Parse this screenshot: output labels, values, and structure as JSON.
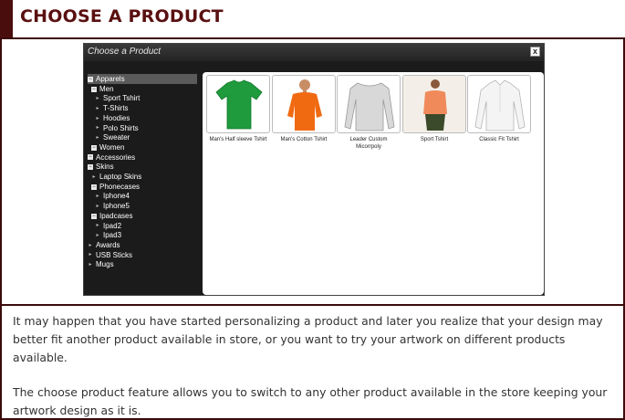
{
  "header": {
    "title": "CHOOSE A PRODUCT"
  },
  "dialog": {
    "title": "Choose a Product",
    "close_label": "x",
    "tree": [
      {
        "label": "Apparels",
        "glyph": "box",
        "selected": true
      },
      {
        "label": "Men",
        "glyph": "box"
      },
      {
        "label": "Sport Tshirt",
        "glyph": "arrow"
      },
      {
        "label": "T-Shirts",
        "glyph": "arrow"
      },
      {
        "label": "Hoodies",
        "glyph": "arrow"
      },
      {
        "label": "Polo Shirts",
        "glyph": "arrow"
      },
      {
        "label": "Sweater",
        "glyph": "arrow"
      },
      {
        "label": "Women",
        "glyph": "box"
      },
      {
        "label": "Accessories",
        "glyph": "box"
      },
      {
        "label": "Skins",
        "glyph": "box"
      },
      {
        "label": "Laptop Skins",
        "glyph": "arrow"
      },
      {
        "label": "Phonecases",
        "glyph": "box"
      },
      {
        "label": "Iphone4",
        "glyph": "arrow"
      },
      {
        "label": "Iphone5",
        "glyph": "arrow"
      },
      {
        "label": "Ipadcases",
        "glyph": "box"
      },
      {
        "label": "Ipad2",
        "glyph": "arrow"
      },
      {
        "label": "Ipad3",
        "glyph": "arrow"
      },
      {
        "label": "Awards",
        "glyph": "arrow"
      },
      {
        "label": "USB Sticks",
        "glyph": "arrow"
      },
      {
        "label": "Mugs",
        "glyph": "arrow"
      }
    ],
    "products": [
      {
        "name": "Man's Half sleeve Tshirt",
        "color": "#1f9a3c"
      },
      {
        "name": "Man's Cotton Tshirt",
        "color": "#f06a12"
      },
      {
        "name": "Leader Custom Micorrpoly",
        "color": "#d8d8d8"
      },
      {
        "name": "Sport Tshirt",
        "color": "#f08a5a"
      },
      {
        "name": "Classic Fit Tshirt",
        "color": "#f4f4f4"
      }
    ]
  },
  "body": {
    "para1": "It may happen that you have started personalizing a product and later you realize that your design may better fit another product available in store, or you want to try your artwork on different products available.",
    "para2": "The choose product feature allows you to switch to any other product available in the store keeping your artwork design as it is."
  },
  "colors": {
    "brand": "#5a1010",
    "frame": "#3c0a0a"
  }
}
